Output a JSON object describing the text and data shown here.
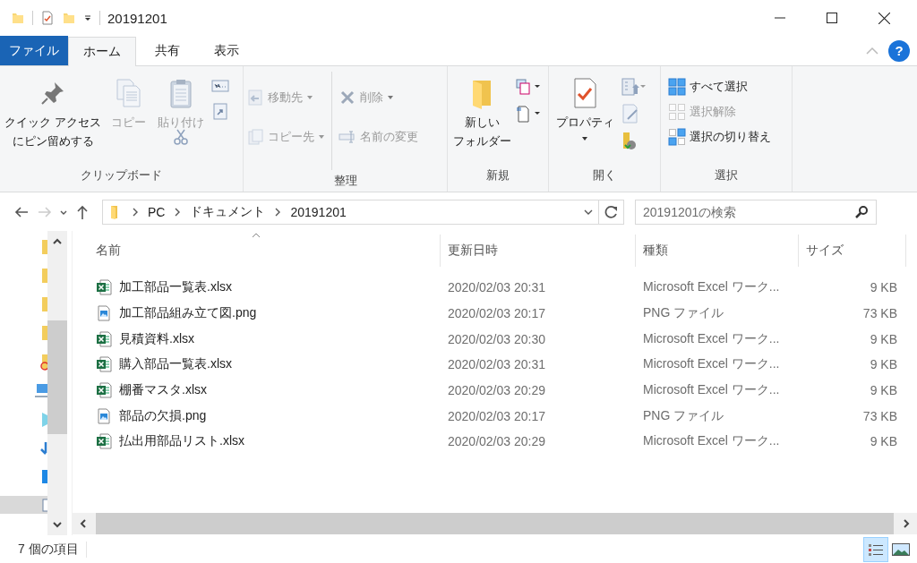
{
  "title_bar": {
    "title": "20191201"
  },
  "ribbon_tabs": [
    {
      "label": "ファイル",
      "kind": "file",
      "selected": false
    },
    {
      "label": "ホーム",
      "kind": "tab",
      "selected": true
    },
    {
      "label": "共有",
      "kind": "tab",
      "selected": false
    },
    {
      "label": "表示",
      "kind": "tab",
      "selected": false
    }
  ],
  "help": "?",
  "ribbon": {
    "clipboard": {
      "label": "クリップボード",
      "pin": {
        "lines": [
          "クイック アクセス",
          "にピン留めする"
        ],
        "disabled": false
      },
      "copy": {
        "lines": [
          "コピー"
        ],
        "disabled": true
      },
      "paste": {
        "lines": [
          "貼り付け"
        ],
        "disabled": true
      }
    },
    "organize": {
      "label": "整理",
      "move_to": {
        "label": "移動先",
        "disabled": true
      },
      "copy_to": {
        "label": "コピー先",
        "disabled": true
      },
      "delete": {
        "label": "削除",
        "disabled": true
      },
      "rename": {
        "label": "名前の変更",
        "disabled": true
      }
    },
    "new": {
      "label": "新規",
      "new_folder": {
        "lines": [
          "新しい",
          "フォルダー"
        ],
        "disabled": false
      }
    },
    "open": {
      "label": "開く",
      "properties": {
        "lines": [
          "プロパティ"
        ],
        "disabled": false
      }
    },
    "select": {
      "label": "選択",
      "select_all": {
        "label": "すべて選択",
        "disabled": false
      },
      "select_none": {
        "label": "選択解除",
        "disabled": true
      },
      "invert": {
        "label": "選択の切り替え",
        "disabled": false
      }
    }
  },
  "address": {
    "path": [
      "PC",
      "ドキュメント",
      "20191201"
    ]
  },
  "search": {
    "placeholder": "20191201の検索"
  },
  "columns": [
    {
      "label": "名前",
      "sorted": true
    },
    {
      "label": "更新日時",
      "sorted": false
    },
    {
      "label": "種類",
      "sorted": false
    },
    {
      "label": "サイズ",
      "sorted": false
    }
  ],
  "rows": [
    {
      "name": "加工部品一覧表.xlsx",
      "kind": "excel",
      "modified": "2020/02/03 20:31",
      "type": "Microsoft Excel ワーク...",
      "size": "9 KB"
    },
    {
      "name": "加工部品組み立て図.png",
      "kind": "image",
      "modified": "2020/02/03 20:17",
      "type": "PNG ファイル",
      "size": "73 KB"
    },
    {
      "name": "見積資料.xlsx",
      "kind": "excel",
      "modified": "2020/02/03 20:30",
      "type": "Microsoft Excel ワーク...",
      "size": "9 KB"
    },
    {
      "name": "購入部品一覧表.xlsx",
      "kind": "excel",
      "modified": "2020/02/03 20:31",
      "type": "Microsoft Excel ワーク...",
      "size": "9 KB"
    },
    {
      "name": "棚番マスタ.xlsx",
      "kind": "excel",
      "modified": "2020/02/03 20:29",
      "type": "Microsoft Excel ワーク...",
      "size": "9 KB"
    },
    {
      "name": "部品の欠損.png",
      "kind": "image",
      "modified": "2020/02/03 20:17",
      "type": "PNG ファイル",
      "size": "73 KB"
    },
    {
      "name": "払出用部品リスト.xlsx",
      "kind": "excel",
      "modified": "2020/02/03 20:29",
      "type": "Microsoft Excel ワーク...",
      "size": "9 KB"
    }
  ],
  "status": {
    "text": "7 個の項目"
  },
  "view_buttons": [
    {
      "kind": "details",
      "selected": true
    },
    {
      "kind": "large_icons",
      "selected": false
    }
  ]
}
